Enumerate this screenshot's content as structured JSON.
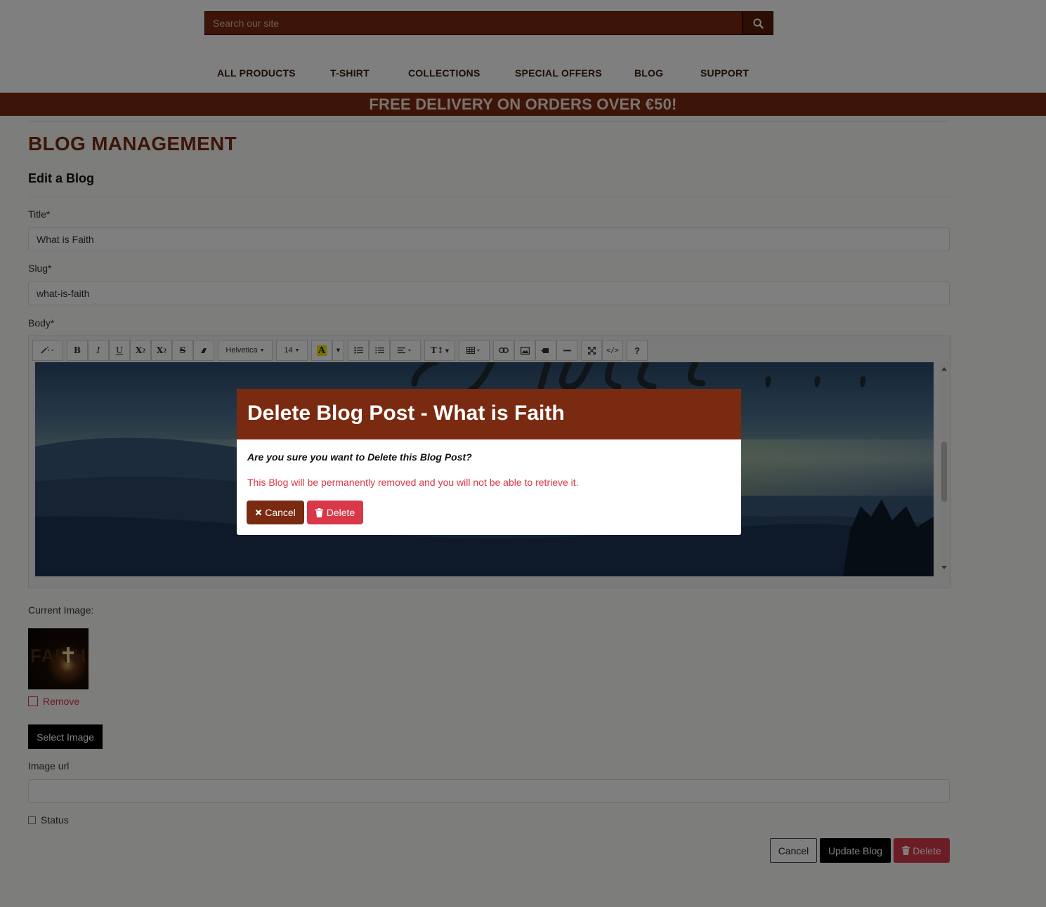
{
  "search": {
    "placeholder": "Search our site"
  },
  "nav": [
    "ALL PRODUCTS",
    "T-SHIRT",
    "COLLECTIONS",
    "SPECIAL OFFERS",
    "BLOG",
    "SUPPORT"
  ],
  "banner": "FREE DELIVERY ON ORDERS OVER €50!",
  "page": {
    "title": "BLOG MANAGEMENT",
    "subtitle": "Edit a Blog",
    "title_label": "Title*",
    "title_value": "What is Faith",
    "slug_label": "Slug*",
    "slug_value": "what-is-faith",
    "body_label": "Body*",
    "current_image_label": "Current Image:",
    "thumb_text": "FAITH",
    "remove_label": "Remove",
    "select_image": "Select Image",
    "image_url_label": "Image url",
    "image_url_value": "",
    "status_label": "Status",
    "cancel": "Cancel",
    "update": "Update Blog",
    "delete": "Delete"
  },
  "toolbar": {
    "bold": "B",
    "italic": "I",
    "underline": "U",
    "superscript": "X",
    "subscript": "X",
    "strike": "S",
    "font": "Helvetica",
    "size": "14",
    "color": "A",
    "help": "?"
  },
  "modal": {
    "title": "Delete Blog Post - What is Faith",
    "question": "Are you sure you want to Delete this Blog Post?",
    "warning": "This Blog will be permanently removed and you will not be able to retrieve it.",
    "cancel": "Cancel",
    "delete": "Delete"
  },
  "colors": {
    "brand": "#7a2a10",
    "danger": "#d93848",
    "dark": "#000000"
  }
}
